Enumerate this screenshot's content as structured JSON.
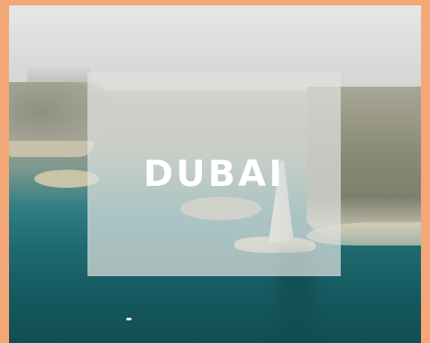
{
  "card": {
    "title": "DUBAI",
    "image_description_icon": "aerial-city-photo",
    "frame_color": "#f4a878",
    "overlay_color": "#dee0de",
    "title_color": "#ffffff"
  }
}
